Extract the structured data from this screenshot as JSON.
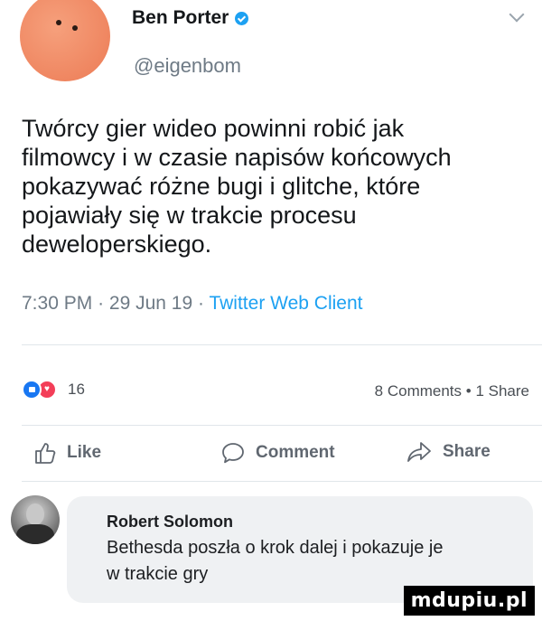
{
  "author": {
    "name": "Ben Porter",
    "handle": "@eigenbom",
    "verified": true
  },
  "tweet": {
    "lines": [
      "Twórcy gier wideo powinni robić jak",
      "filmowcy i w czasie napisów końcowych",
      "pokazywać różne bugi i glitche, które",
      "pojawiały się w trakcie procesu",
      "deweloperskiego."
    ],
    "time": "7:30 PM",
    "date": "29 Jun 19",
    "client": "Twitter Web Client",
    "separator": "·"
  },
  "reactions": {
    "count": "16",
    "comments": "8 Comments",
    "shares": "1 Share",
    "separator": "•"
  },
  "actions": {
    "like": "Like",
    "comment": "Comment",
    "share": "Share"
  },
  "comment": {
    "author": "Robert Solomon",
    "lines": [
      "Bethesda poszła o krok dalej i pokazuje je",
      "w trakcie gry"
    ]
  },
  "watermark": "mdupiu.pl",
  "colors": {
    "link_blue": "#1da1f2",
    "avatar_orange": "#ec7b55",
    "like_blue": "#1877f2",
    "love_red": "#f33e58"
  }
}
